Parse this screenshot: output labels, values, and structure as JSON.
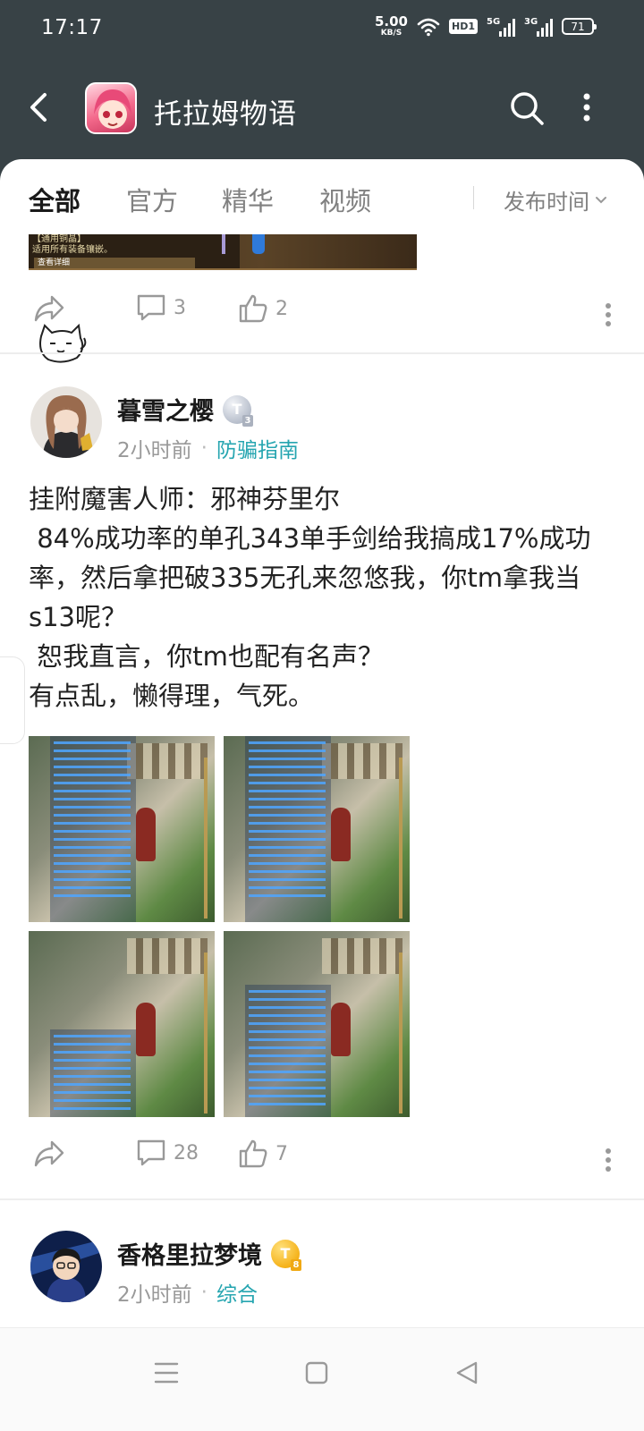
{
  "status_bar": {
    "time": "17:17",
    "net_speed_value": "5.00",
    "net_speed_unit": "KB/S",
    "hd_label": "HD1",
    "signal_1_label": "5G",
    "signal_2_label": "3G",
    "battery": "71"
  },
  "header": {
    "title": "托拉姆物语",
    "back_icon": "chevron-left-icon",
    "search_icon": "search-icon",
    "more_icon": "more-vertical-icon"
  },
  "tabs": [
    {
      "label": "全部",
      "active": true
    },
    {
      "label": "官方",
      "active": false
    },
    {
      "label": "精华",
      "active": false
    },
    {
      "label": "视频",
      "active": false
    }
  ],
  "sort": {
    "label": "发布时间"
  },
  "prev_post": {
    "image_text_title": "【通用铜晶】",
    "image_text_line": "适用所有装备镶嵌。",
    "image_button": "查看详细",
    "comments": "3",
    "likes": "2"
  },
  "post": {
    "author": "暮雪之樱",
    "level_badge": "T",
    "level_num": "3",
    "time": "2小时前",
    "topic": "防骗指南",
    "body": "挂附魔害人师：邪神芬里尔\n 84%成功率的单孔343单手剑给我搞成17%成功率，然后拿把破335无孔来忽悠我，你tm拿我当s13呢？\n 恕我直言，你tm也配有名声？\n有点乱，懒得理，气死。",
    "image_count": 4,
    "comments": "28",
    "likes": "7"
  },
  "next_post": {
    "author": "香格里拉梦境",
    "level_badge": "T",
    "level_num": "8",
    "time": "2小时前",
    "topic": "综合"
  },
  "colors": {
    "header_bg": "#384246",
    "accent": "#25a5b0",
    "badge_gold": "#f5b21a",
    "badge_silver": "#b8bfcc"
  }
}
